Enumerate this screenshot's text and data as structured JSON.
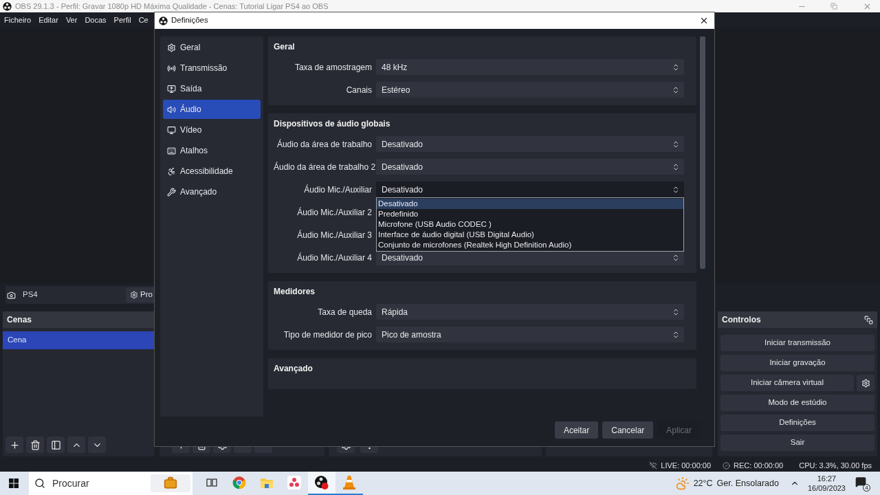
{
  "main_window": {
    "title": "OBS 29.1.3 - Perfil: Gravar 1080p HD Máxima Qualidade - Cenas: Tutorial Ligar PS4 ao OBS",
    "menu": [
      "Ficheiro",
      "Editar",
      "Ver",
      "Docas",
      "Perfil",
      "Ce"
    ],
    "source_bar": {
      "source": "PS4",
      "properties_button": "Pro"
    },
    "scenes": {
      "title": "Cenas",
      "items": [
        {
          "label": "Cena",
          "selected": true
        }
      ]
    },
    "controls": {
      "title": "Controlos",
      "buttons": [
        {
          "label": "Iniciar transmissão",
          "kind": "plain"
        },
        {
          "label": "Iniciar gravação",
          "kind": "plain"
        },
        {
          "label": "Iniciar câmera virtual",
          "kind": "with_settings"
        },
        {
          "label": "Modo de estúdio",
          "kind": "plain"
        },
        {
          "label": "Definições",
          "kind": "plain"
        },
        {
          "label": "Sair",
          "kind": "plain"
        }
      ]
    },
    "status_bar": {
      "live": "LIVE: 00:00:00",
      "rec": "REC: 00:00:00",
      "cpu": "CPU: 3.3%, 30.00 fps"
    }
  },
  "dialog": {
    "title": "Definições",
    "sidebar": [
      {
        "label": "Geral",
        "selected": false
      },
      {
        "label": "Transmissão",
        "selected": false
      },
      {
        "label": "Saída",
        "selected": false
      },
      {
        "label": "Áudio",
        "selected": true
      },
      {
        "label": "Vídeo",
        "selected": false
      },
      {
        "label": "Atalhos",
        "selected": false
      },
      {
        "label": "Acessibilidade",
        "selected": false
      },
      {
        "label": "Avançado",
        "selected": false
      }
    ],
    "sections": [
      {
        "title": "Geral",
        "fields": [
          {
            "label": "Taxa de amostragem",
            "value": "48 kHz",
            "open": false
          },
          {
            "label": "Canais",
            "value": "Estéreo",
            "open": false
          }
        ]
      },
      {
        "title": "Dispositivos de áudio globais",
        "fields": [
          {
            "label": "Áudio da área de trabalho",
            "value": "Desativado",
            "open": false
          },
          {
            "label": "Áudio da área de trabalho 2",
            "value": "Desativado",
            "open": false
          },
          {
            "label": "Áudio Mic./Auxiliar",
            "value": "Desativado",
            "open": true,
            "options": [
              {
                "label": "Desativado",
                "selected": true
              },
              {
                "label": "Predefinido",
                "selected": false
              },
              {
                "label": "Microfone (USB Audio CODEC )",
                "selected": false
              },
              {
                "label": "Interface de áudio digital (USB Digital Audio)",
                "selected": false
              },
              {
                "label": "Conjunto de microfones (Realtek High Definition Audio)",
                "selected": false
              }
            ]
          },
          {
            "label": "Áudio Mic./Auxiliar 2"
          },
          {
            "label": "Áudio Mic./Auxiliar 3"
          },
          {
            "label": "Áudio Mic./Auxiliar 4",
            "value": "Desativado",
            "open": false
          }
        ]
      },
      {
        "title": "Medidores",
        "fields": [
          {
            "label": "Taxa de queda",
            "value": "Rápida",
            "open": false
          },
          {
            "label": "Tipo de medidor de pico",
            "value": "Pico de amostra",
            "open": false
          }
        ]
      },
      {
        "title": "Avançado"
      }
    ],
    "buttons": [
      {
        "label": "Aceitar",
        "disabled": false
      },
      {
        "label": "Cancelar",
        "disabled": false
      },
      {
        "label": "Aplicar",
        "disabled": true
      }
    ]
  },
  "taskbar": {
    "search_placeholder": "Procurar",
    "apps": [
      {
        "running": false,
        "selected": false
      },
      {
        "running": false,
        "selected": false
      },
      {
        "running": false,
        "selected": false
      },
      {
        "running": false,
        "selected": false
      },
      {
        "running": true,
        "selected": true
      },
      {
        "running": true,
        "selected": false
      }
    ],
    "temperature": "22°C",
    "weather": "Ger. Ensolarado",
    "time": "16:27",
    "date": "16/09/2023",
    "notifications": "4"
  }
}
